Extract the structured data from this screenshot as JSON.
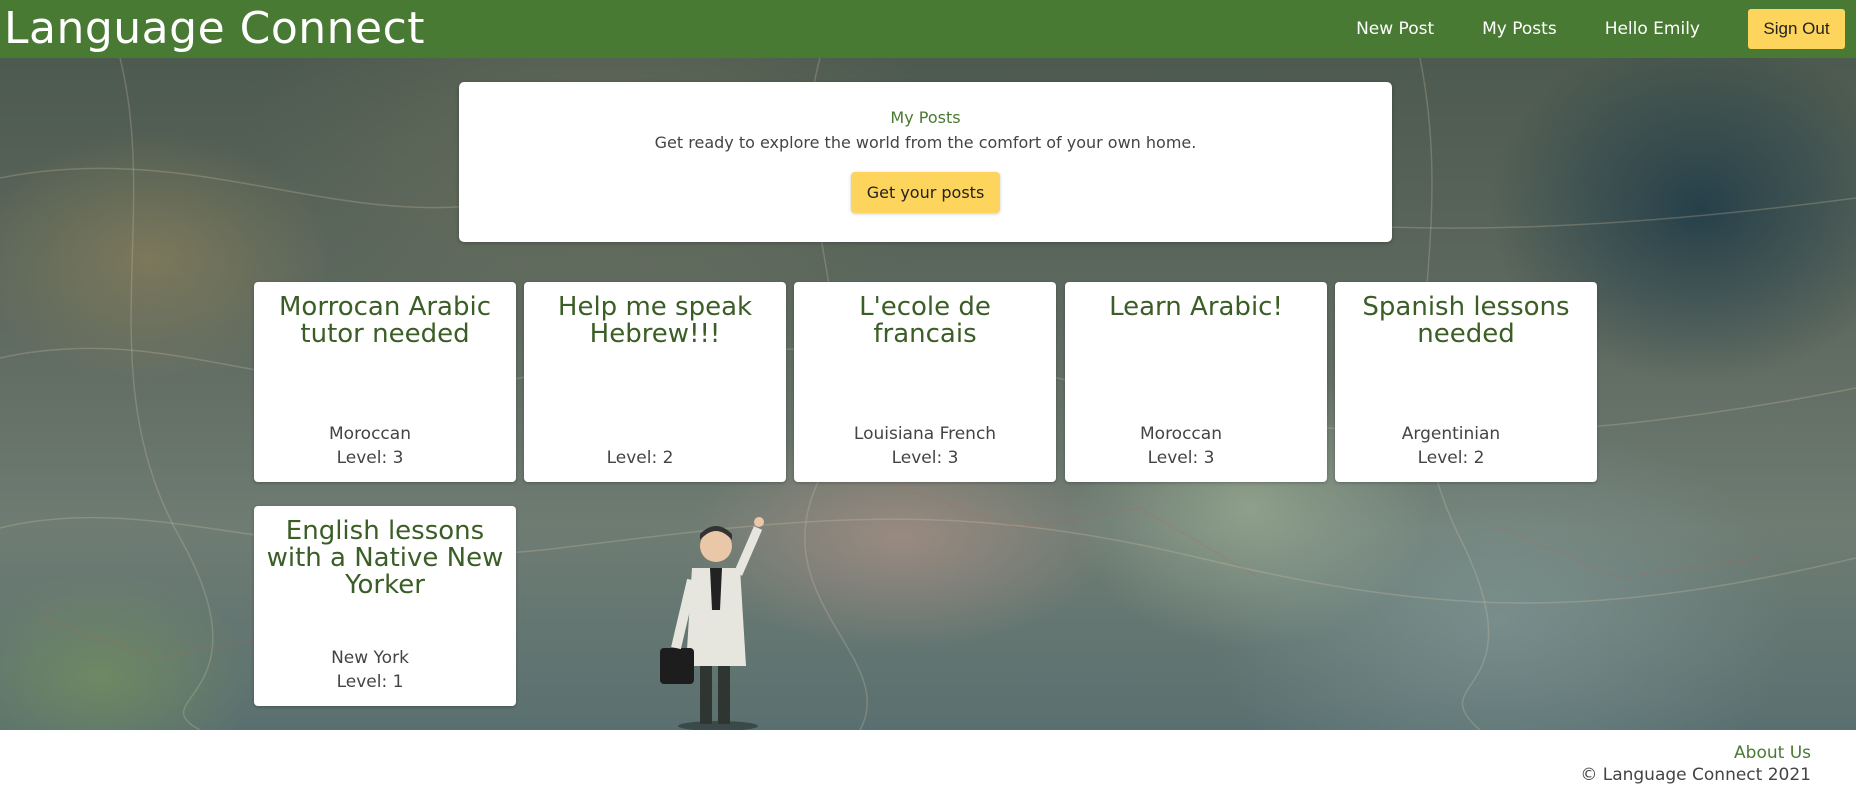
{
  "app": {
    "brand": "Language Connect"
  },
  "nav": {
    "new_post": "New Post",
    "my_posts": "My Posts",
    "greeting": "Hello Emily",
    "sign_out": "Sign Out"
  },
  "intro": {
    "title": "My Posts",
    "subtitle": "Get ready to explore the world from the comfort of your own home.",
    "button": "Get your posts"
  },
  "posts": [
    {
      "title": "Morrocan Arabic tutor needed",
      "dialect": "Moroccan",
      "level": "Level: 3"
    },
    {
      "title": "Help me speak Hebrew!!!",
      "dialect": "",
      "level": "Level: 2"
    },
    {
      "title": "L'ecole de francais",
      "dialect": "Louisiana French",
      "level": "Level: 3"
    },
    {
      "title": "Learn Arabic!",
      "dialect": "Moroccan",
      "level": "Level: 3"
    },
    {
      "title": "Spanish lessons needed",
      "dialect": "Argentinian",
      "level": "Level: 2"
    },
    {
      "title": "English lessons with a Native New Yorker",
      "dialect": "New York",
      "level": "Level: 1"
    }
  ],
  "footer": {
    "about": "About Us",
    "copyright": "© Language Connect 2021"
  },
  "colors": {
    "navbar": "#497a33",
    "accent_button": "#fdd45c",
    "card_title": "#3b5e26"
  }
}
